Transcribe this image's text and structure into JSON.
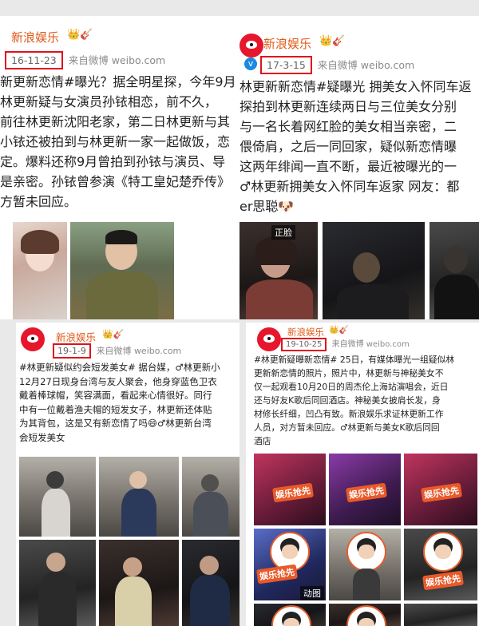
{
  "account_name": "新浪娱乐",
  "badge_icons": "👑🎸",
  "source_label": "来自微博",
  "source_domain": "weibo.com",
  "posts": [
    {
      "date": "16-11-23",
      "lines": [
        "新更新恋情#曝光？据全明星探，今年9月",
        "林更新疑与女演员孙铱相恋，前不久，",
        "前往林更新沈阳老家，第二日林更新与其",
        "小铱还被拍到与林更新一家一起做饭，恋",
        "定。爆料还称9月曾拍到孙铱与演员、导",
        "是亲密。孙铱曾参演《特工皇妃楚乔传》",
        "方暂未回应。"
      ]
    },
    {
      "date": "17-3-15",
      "lines": [
        "林更新新恋情#疑曝光 拥美女入怀同车返",
        "探拍到林更新连续两日与三位美女分别",
        "与一名长着网红脸的美女相当亲密，二",
        "偎倚肩，之后一同回家，疑似新恋情曝",
        "这两年绯闻一直不断，最近被曝光的一",
        "♂林更新拥美女入怀同车返家 网友：都",
        "er思聪🐶"
      ],
      "photo_label": "正脸"
    },
    {
      "date": "19-1-9",
      "lines": [
        "#林更新疑似约会短发美女# 据台媒，♂林更新小",
        "12月27日现身台湾与友人聚会，他身穿蓝色卫衣",
        "戴着棒球帽，笑容满面，看起来心情很好。同行",
        "中有一位戴着渔夫帽的短发女子，林更新还体贴",
        "为其背包，这是又有新恋情了吗😄♂林更新台湾",
        "会短发美女"
      ]
    },
    {
      "date": "19-10-25",
      "lines": [
        "#林更新疑曝新恋情# 25日，有媒体曝光一组疑似林",
        "更新新恋情的照片，照片中，林更新与神秘美女不",
        "仅一起观看10月20日的周杰伦上海站演唱会，近日",
        "还与好友K歌后同回酒店。神秘美女披肩长发，身",
        "材修长纤细，凹凸有致。新浪娱乐求证林更新工作",
        "人员，对方暂未回应。♂林更新与美女K歌后同回",
        "酒店"
      ],
      "watermark": "娱乐抢先",
      "gif_label": "动图"
    }
  ]
}
